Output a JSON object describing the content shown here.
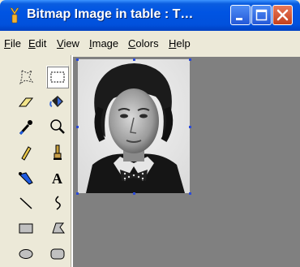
{
  "window": {
    "title": "Bitmap Image in table : T…"
  },
  "title_buttons": [
    "minimize",
    "maximize",
    "close"
  ],
  "menu": [
    "File",
    "Edit",
    "View",
    "Image",
    "Colors",
    "Help"
  ],
  "tools": [
    {
      "name": "free-form-select-icon"
    },
    {
      "name": "rect-select-icon",
      "selected": true
    },
    {
      "name": "eraser-icon"
    },
    {
      "name": "fill-bucket-icon"
    },
    {
      "name": "color-picker-icon"
    },
    {
      "name": "magnifier-icon"
    },
    {
      "name": "pencil-icon"
    },
    {
      "name": "brush-icon"
    },
    {
      "name": "airbrush-icon"
    },
    {
      "name": "text-icon",
      "glyph": "A"
    },
    {
      "name": "line-icon"
    },
    {
      "name": "curve-icon"
    },
    {
      "name": "rectangle-icon"
    },
    {
      "name": "polygon-icon"
    },
    {
      "name": "ellipse-icon"
    },
    {
      "name": "rounded-rect-icon"
    }
  ],
  "colors": {
    "canvas_bg": "#808080",
    "titlebar": "#0054e3",
    "handle": "#2b4bd8"
  },
  "image": {
    "description_name": "portrait-photo"
  }
}
